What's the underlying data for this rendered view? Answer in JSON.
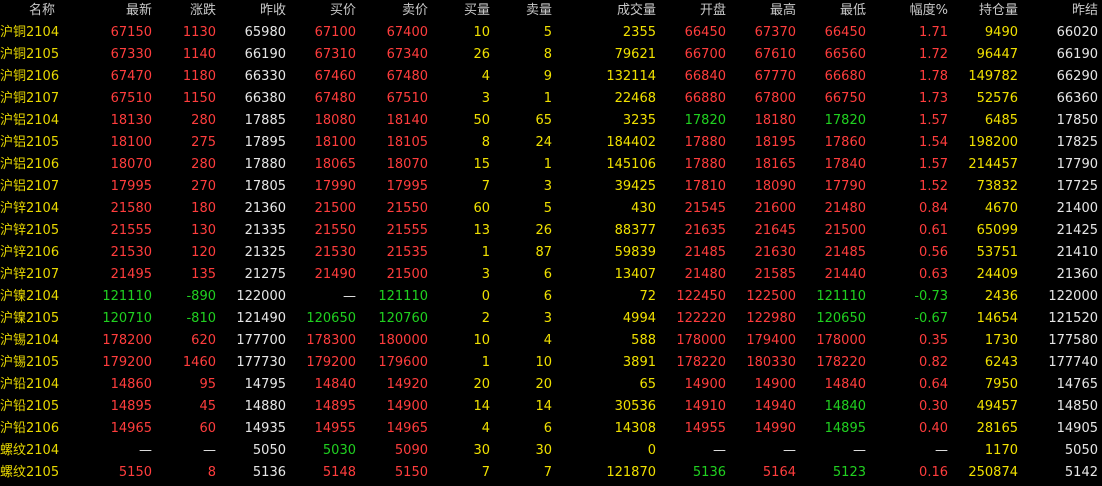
{
  "colors": {
    "background": "#000000",
    "up": "#ff3d3d",
    "down": "#20d020",
    "flat": "#e6e6e6",
    "volume": "#f0e000",
    "header": "#c8c8c8"
  },
  "headers": [
    "名称",
    "最新",
    "涨跌",
    "昨收",
    "买价",
    "卖价",
    "买量",
    "卖量",
    "成交量",
    "开盘",
    "最高",
    "最低",
    "幅度%",
    "持仓量",
    "昨结"
  ],
  "rows": [
    {
      "name": "沪铜2104",
      "last": "67150",
      "chg": "1130",
      "prev": "65980",
      "bid": "67100",
      "ask": "67400",
      "bidvol": "10",
      "askvol": "5",
      "vol": "2355",
      "open": "66450",
      "high": "67370",
      "low": "66450",
      "pct": "1.71",
      "oi": "9490",
      "settle": "66020"
    },
    {
      "name": "沪铜2105",
      "last": "67330",
      "chg": "1140",
      "prev": "66190",
      "bid": "67310",
      "ask": "67340",
      "bidvol": "26",
      "askvol": "8",
      "vol": "79621",
      "open": "66700",
      "high": "67610",
      "low": "66560",
      "pct": "1.72",
      "oi": "96447",
      "settle": "66190"
    },
    {
      "name": "沪铜2106",
      "last": "67470",
      "chg": "1180",
      "prev": "66330",
      "bid": "67460",
      "ask": "67480",
      "bidvol": "4",
      "askvol": "9",
      "vol": "132114",
      "open": "66840",
      "high": "67770",
      "low": "66680",
      "pct": "1.78",
      "oi": "149782",
      "settle": "66290"
    },
    {
      "name": "沪铜2107",
      "last": "67510",
      "chg": "1150",
      "prev": "66380",
      "bid": "67480",
      "ask": "67510",
      "bidvol": "3",
      "askvol": "1",
      "vol": "22468",
      "open": "66880",
      "high": "67800",
      "low": "66750",
      "pct": "1.73",
      "oi": "52576",
      "settle": "66360"
    },
    {
      "name": "沪铝2104",
      "last": "18130",
      "chg": "280",
      "prev": "17885",
      "bid": "18080",
      "ask": "18140",
      "bidvol": "50",
      "askvol": "65",
      "vol": "3235",
      "open": "17820",
      "high": "18180",
      "low": "17820",
      "pct": "1.57",
      "oi": "6485",
      "settle": "17850"
    },
    {
      "name": "沪铝2105",
      "last": "18100",
      "chg": "275",
      "prev": "17895",
      "bid": "18100",
      "ask": "18105",
      "bidvol": "8",
      "askvol": "24",
      "vol": "184402",
      "open": "17880",
      "high": "18195",
      "low": "17860",
      "pct": "1.54",
      "oi": "198200",
      "settle": "17825"
    },
    {
      "name": "沪铝2106",
      "last": "18070",
      "chg": "280",
      "prev": "17880",
      "bid": "18065",
      "ask": "18070",
      "bidvol": "15",
      "askvol": "1",
      "vol": "145106",
      "open": "17880",
      "high": "18165",
      "low": "17840",
      "pct": "1.57",
      "oi": "214457",
      "settle": "17790"
    },
    {
      "name": "沪铝2107",
      "last": "17995",
      "chg": "270",
      "prev": "17805",
      "bid": "17990",
      "ask": "17995",
      "bidvol": "7",
      "askvol": "3",
      "vol": "39425",
      "open": "17810",
      "high": "18090",
      "low": "17790",
      "pct": "1.52",
      "oi": "73832",
      "settle": "17725"
    },
    {
      "name": "沪锌2104",
      "last": "21580",
      "chg": "180",
      "prev": "21360",
      "bid": "21500",
      "ask": "21550",
      "bidvol": "60",
      "askvol": "5",
      "vol": "430",
      "open": "21545",
      "high": "21600",
      "low": "21480",
      "pct": "0.84",
      "oi": "4670",
      "settle": "21400"
    },
    {
      "name": "沪锌2105",
      "last": "21555",
      "chg": "130",
      "prev": "21335",
      "bid": "21550",
      "ask": "21555",
      "bidvol": "13",
      "askvol": "26",
      "vol": "88377",
      "open": "21635",
      "high": "21645",
      "low": "21500",
      "pct": "0.61",
      "oi": "65099",
      "settle": "21425"
    },
    {
      "name": "沪锌2106",
      "last": "21530",
      "chg": "120",
      "prev": "21325",
      "bid": "21530",
      "ask": "21535",
      "bidvol": "1",
      "askvol": "87",
      "vol": "59839",
      "open": "21485",
      "high": "21630",
      "low": "21485",
      "pct": "0.56",
      "oi": "53751",
      "settle": "21410"
    },
    {
      "name": "沪锌2107",
      "last": "21495",
      "chg": "135",
      "prev": "21275",
      "bid": "21490",
      "ask": "21500",
      "bidvol": "3",
      "askvol": "6",
      "vol": "13407",
      "open": "21480",
      "high": "21585",
      "low": "21440",
      "pct": "0.63",
      "oi": "24409",
      "settle": "21360"
    },
    {
      "name": "沪镍2104",
      "last": "121110",
      "chg": "-890",
      "prev": "122000",
      "bid": "—",
      "ask": "121110",
      "bidvol": "0",
      "askvol": "6",
      "vol": "72",
      "open": "122450",
      "high": "122500",
      "low": "121110",
      "pct": "-0.73",
      "oi": "2436",
      "settle": "122000"
    },
    {
      "name": "沪镍2105",
      "last": "120710",
      "chg": "-810",
      "prev": "121490",
      "bid": "120650",
      "ask": "120760",
      "bidvol": "2",
      "askvol": "3",
      "vol": "4994",
      "open": "122220",
      "high": "122980",
      "low": "120650",
      "pct": "-0.67",
      "oi": "14654",
      "settle": "121520"
    },
    {
      "name": "沪锡2104",
      "last": "178200",
      "chg": "620",
      "prev": "177700",
      "bid": "178300",
      "ask": "180000",
      "bidvol": "10",
      "askvol": "4",
      "vol": "588",
      "open": "178000",
      "high": "179400",
      "low": "178000",
      "pct": "0.35",
      "oi": "1730",
      "settle": "177580"
    },
    {
      "name": "沪锡2105",
      "last": "179200",
      "chg": "1460",
      "prev": "177730",
      "bid": "179200",
      "ask": "179600",
      "bidvol": "1",
      "askvol": "10",
      "vol": "3891",
      "open": "178220",
      "high": "180330",
      "low": "178220",
      "pct": "0.82",
      "oi": "6243",
      "settle": "177740"
    },
    {
      "name": "沪铅2104",
      "last": "14860",
      "chg": "95",
      "prev": "14795",
      "bid": "14840",
      "ask": "14920",
      "bidvol": "20",
      "askvol": "20",
      "vol": "65",
      "open": "14900",
      "high": "14900",
      "low": "14840",
      "pct": "0.64",
      "oi": "7950",
      "settle": "14765"
    },
    {
      "name": "沪铅2105",
      "last": "14895",
      "chg": "45",
      "prev": "14880",
      "bid": "14895",
      "ask": "14900",
      "bidvol": "14",
      "askvol": "14",
      "vol": "30536",
      "open": "14910",
      "high": "14940",
      "low": "14840",
      "pct": "0.30",
      "oi": "49457",
      "settle": "14850"
    },
    {
      "name": "沪铅2106",
      "last": "14965",
      "chg": "60",
      "prev": "14935",
      "bid": "14955",
      "ask": "14965",
      "bidvol": "4",
      "askvol": "6",
      "vol": "14308",
      "open": "14955",
      "high": "14990",
      "low": "14895",
      "pct": "0.40",
      "oi": "28165",
      "settle": "14905"
    },
    {
      "name": "螺纹2104",
      "last": "—",
      "chg": "—",
      "prev": "5050",
      "bid": "5030",
      "ask": "5090",
      "bidvol": "30",
      "askvol": "30",
      "vol": "0",
      "open": "—",
      "high": "—",
      "low": "—",
      "pct": "—",
      "oi": "1170",
      "settle": "5050"
    },
    {
      "name": "螺纹2105",
      "last": "5150",
      "chg": "8",
      "prev": "5136",
      "bid": "5148",
      "ask": "5150",
      "bidvol": "7",
      "askvol": "7",
      "vol": "121870",
      "open": "5136",
      "high": "5164",
      "low": "5123",
      "pct": "0.16",
      "oi": "250874",
      "settle": "5142"
    }
  ]
}
